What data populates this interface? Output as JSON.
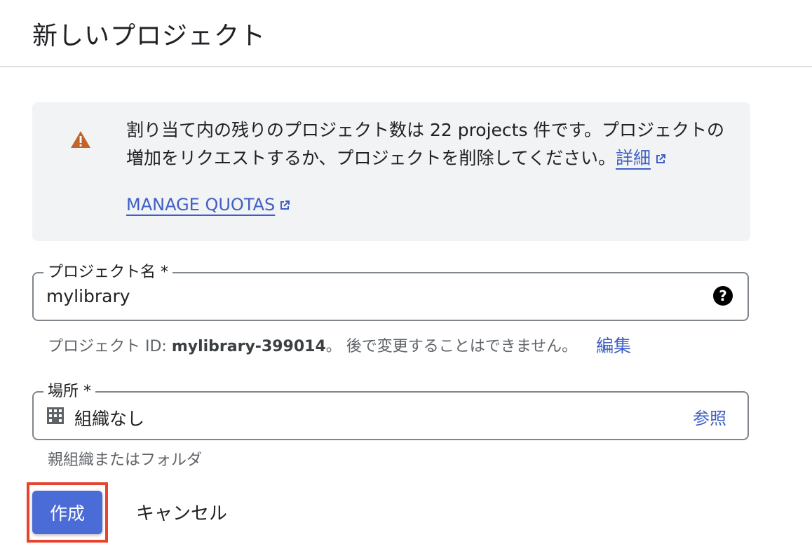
{
  "header": {
    "title": "新しいプロジェクト"
  },
  "alert": {
    "message": "割り当て内の残りのプロジェクト数は 22 projects 件です。プロジェクトの増加をリクエストするか、プロジェクトを削除してください。",
    "details_link": "詳細",
    "manage_quotas_link": "MANAGE QUOTAS",
    "icon": "warning-icon",
    "icon_color": "#c1652c"
  },
  "project_name": {
    "label": "プロジェクト名 *",
    "value": "mylibrary",
    "help_icon": "help-circle-icon"
  },
  "project_id_hint": {
    "prefix": "プロジェクト ID: ",
    "id": "mylibrary-399014",
    "suffix": "。 後で変更することはできません。",
    "edit_link": "編集"
  },
  "location": {
    "label": "場所 *",
    "value": "組織なし",
    "browse_link": "参照",
    "icon": "building-icon",
    "hint": "親組織またはフォルダ"
  },
  "actions": {
    "create_label": "作成",
    "cancel_label": "キャンセル"
  },
  "colors": {
    "accent": "#4b6bd6",
    "link": "#3f5fc6",
    "highlight": "#e8432e"
  }
}
